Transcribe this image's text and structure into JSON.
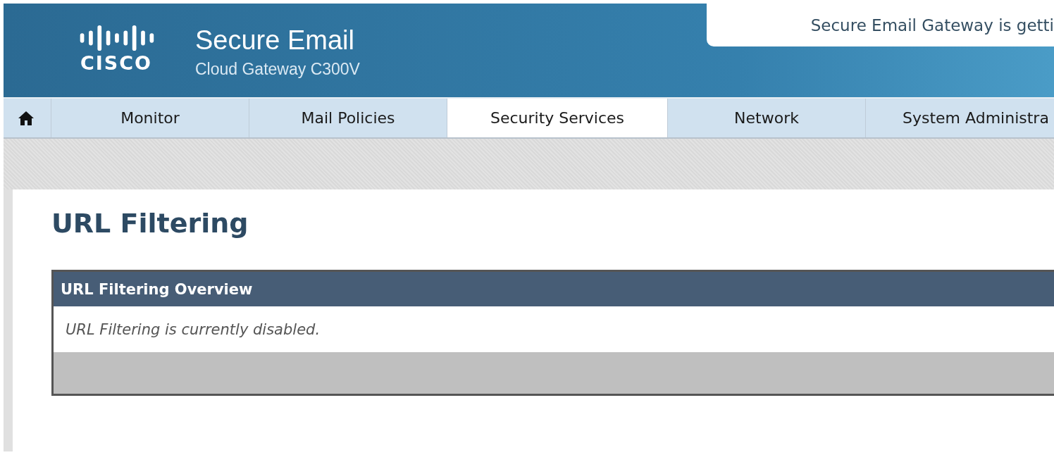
{
  "header": {
    "logo_text": "CISCO",
    "product_title": "Secure Email",
    "product_subtitle": "Cloud Gateway C300V",
    "notice": "Secure Email Gateway is getti"
  },
  "nav_tabs": [
    {
      "label": "Monitor",
      "selected": false
    },
    {
      "label": "Mail Policies",
      "selected": false
    },
    {
      "label": "Security Services",
      "selected": true
    },
    {
      "label": "Network",
      "selected": false
    },
    {
      "label": "System Administra",
      "selected": false
    }
  ],
  "page_title": "URL Filtering",
  "panel": {
    "title": "URL Filtering Overview",
    "message": "URL Filtering is currently disabled."
  }
}
